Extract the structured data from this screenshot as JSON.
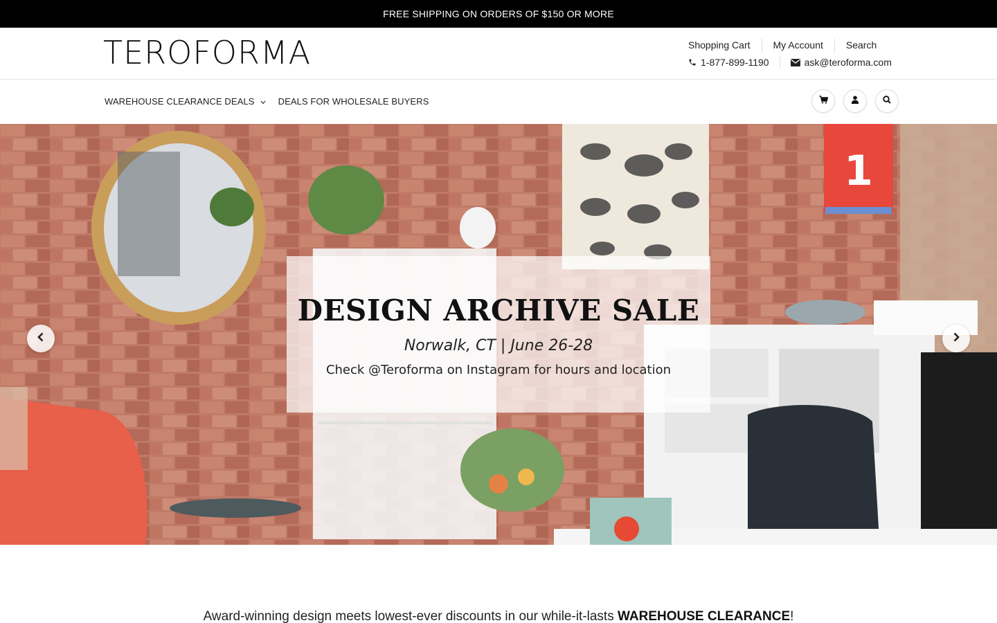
{
  "announcement": "FREE SHIPPING ON ORDERS OF $150 OR MORE",
  "brand": {
    "logo": "TEROFORMA"
  },
  "header": {
    "links": [
      "Shopping Cart",
      "My Account",
      "Search"
    ],
    "phone": "1-877-899-1190",
    "email": "ask@teroforma.com"
  },
  "nav": {
    "items": [
      {
        "label": "WAREHOUSE CLEARANCE DEALS",
        "has_dropdown": true
      },
      {
        "label": "DEALS FOR WHOLESALE BUYERS",
        "has_dropdown": false
      }
    ],
    "icons": [
      "cart-icon",
      "user-icon",
      "search-icon"
    ]
  },
  "hero": {
    "title": "DESIGN ARCHIVE SALE",
    "subtitle": "Norwalk, CT | June 26-28",
    "note": "Check @Teroforma on Instagram for hours and location",
    "calendar_number": "1"
  },
  "promo": {
    "text": "Award-winning design meets lowest-ever discounts in our while-it-lasts ",
    "highlight": "WAREHOUSE CLEARANCE",
    "suffix": "!"
  },
  "colors": {
    "announcement_bg": "#000000",
    "brick": "#b9735f",
    "accent_red": "#e8473c"
  }
}
